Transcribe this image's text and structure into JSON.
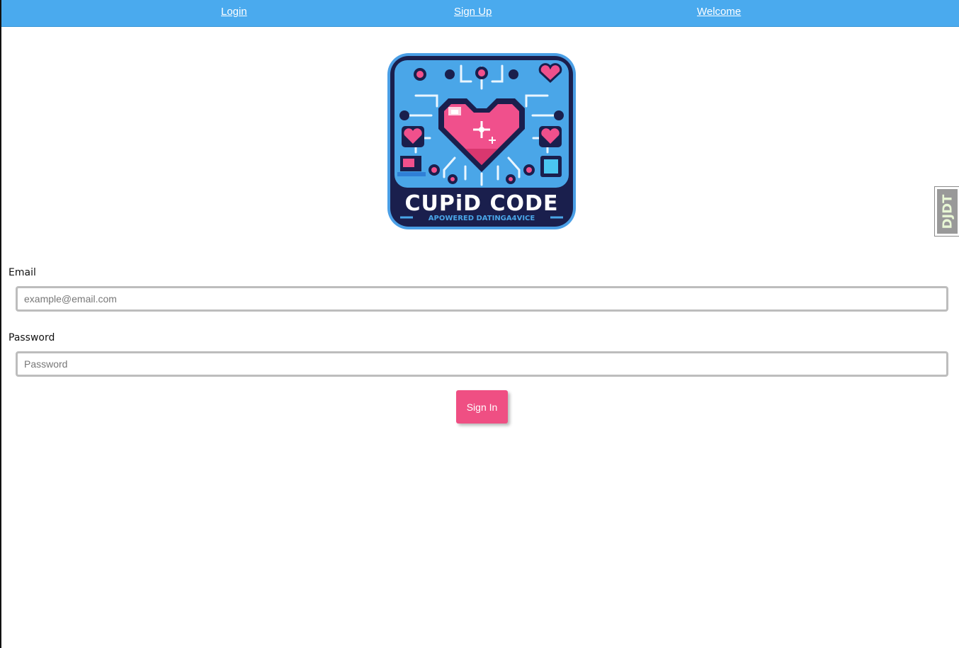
{
  "nav": {
    "login": "Login",
    "signup": "Sign Up",
    "welcome": "Welcome"
  },
  "logo": {
    "title": "CUPiD CODE",
    "tagline": "APOWERED DATINGA4VICE",
    "colors": {
      "frame": "#4a9fe6",
      "inner": "#4aa6e8",
      "dark": "#1a1f4d",
      "heart": "#f0508c"
    }
  },
  "form": {
    "email": {
      "label": "Email",
      "placeholder": "example@email.com",
      "value": ""
    },
    "password": {
      "label": "Password",
      "placeholder": "Password",
      "value": ""
    },
    "submit_label": "Sign In"
  },
  "debug_toolbar": {
    "label": "DJDT"
  },
  "colors": {
    "nav_bg": "#4aaaee",
    "button_bg": "#ef4f83"
  }
}
